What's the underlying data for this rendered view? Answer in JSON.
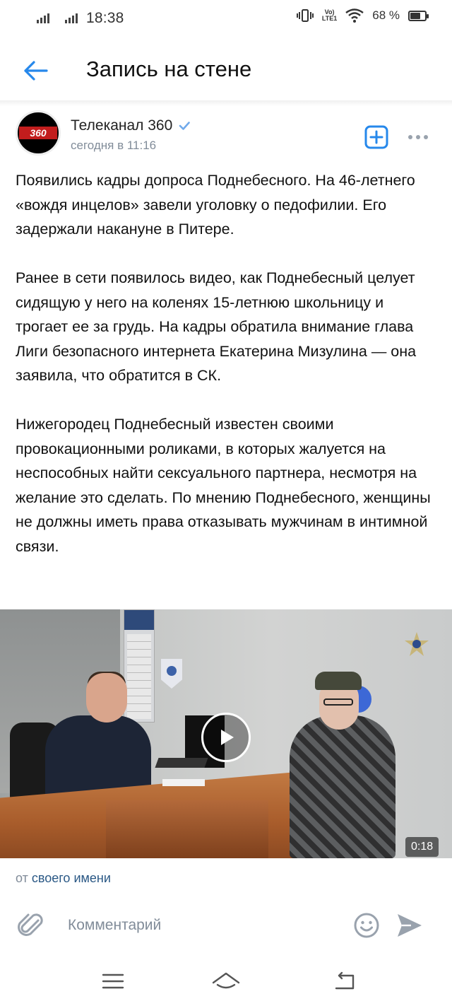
{
  "status_bar": {
    "time": "18:38",
    "volte_label": "Vo)\nLTE1",
    "battery_percent": "68 %",
    "battery_level": 0.68
  },
  "header": {
    "title": "Запись на стене",
    "back_icon": "arrow-left-icon"
  },
  "post": {
    "author": "Телеканал 360",
    "avatar_text": "360",
    "verified": true,
    "time": "сегодня в 11:16",
    "paragraphs": [
      "Появились кадры допроса Поднебесного. На 46-летнего «вождя инцелов» завели уголовку о педофилии. Его задержали накануне в Питере.",
      "Ранее в сети появилось видео, как Поднебесный целует сидящую у него на коленях 15-летнюю школьницу и трогает ее за грудь. На кадры обратила внимание глава Лиги безопасного интернета Екатерина Мизулина — она заявила, что обратится в СК.",
      "Нижегородец Поднебесный известен своими провокационными роликами, в которых жалуется на неспособных найти сексуального партнера, несмотря на желание это сделать. По мнению Поднебесного, женщины не должны иметь права отказывать мужчинам в интимной связи."
    ],
    "video": {
      "duration": "0:18"
    }
  },
  "sender": {
    "prefix": "от",
    "link": "своего имени"
  },
  "comment": {
    "placeholder": "Комментарий"
  },
  "colors": {
    "accent": "#2688eb",
    "secondary_text": "#818c99",
    "link": "#2a5885",
    "icon_gray": "#99a2ad"
  }
}
